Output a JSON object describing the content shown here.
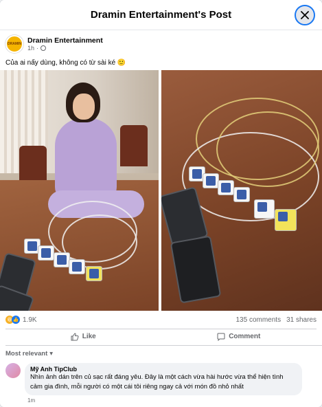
{
  "header": {
    "title": "Dramin Entertainment's Post",
    "close_icon": "close-icon"
  },
  "post": {
    "author": "Dramin Entertainment",
    "time": "1h",
    "privacy_icon": "globe-icon",
    "text": "Của ai nấy dùng, không có từ sài ké 🙂",
    "avatar_icon": "page-avatar"
  },
  "photos": {
    "left_description": "girl-with-chargers",
    "right_description": "chargers-with-photos"
  },
  "stats": {
    "reactions": [
      "haha-icon",
      "like-icon"
    ],
    "reaction_count": "1.9K",
    "comments": "135 comments",
    "shares": "31 shares"
  },
  "actions": {
    "like": "Like",
    "comment": "Comment"
  },
  "comments": {
    "sort_label": "Most relevant",
    "items": [
      {
        "author": "Mỹ Anh TipClub",
        "text": "Nhìn ảnh dán trên củ sạc rất đáng yêu. Đây là một cách vừa hài hước vừa thể hiện tình cảm gia đình, mỗi người có một cái tôi riêng ngay cả với món đồ nhỏ nhất",
        "time": "1m"
      }
    ]
  },
  "colors": {
    "accent": "#1877f2",
    "text_secondary": "#65676b",
    "divider": "#ced0d4"
  }
}
